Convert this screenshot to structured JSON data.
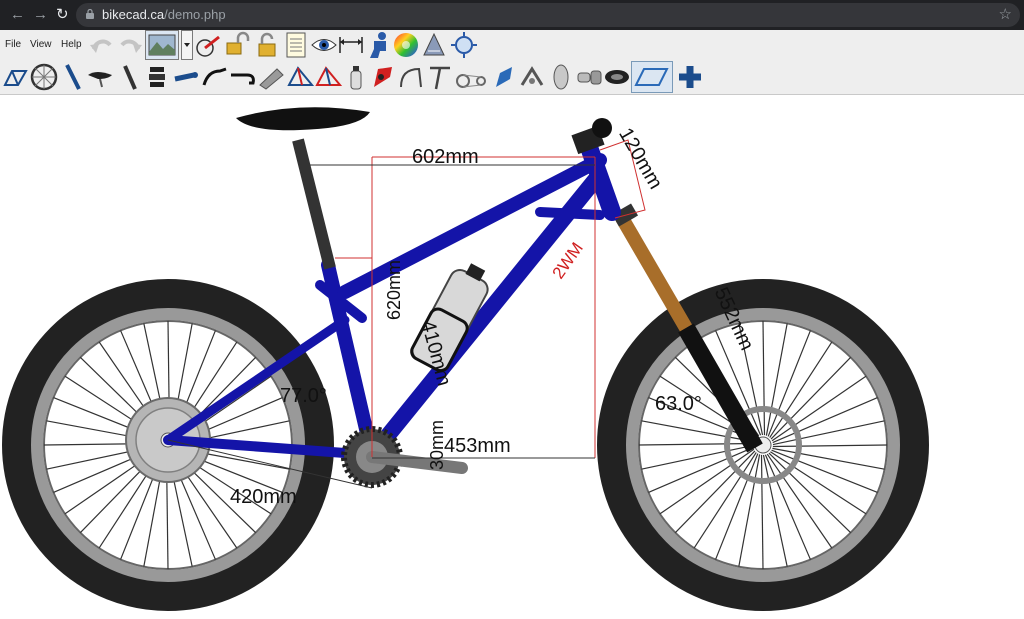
{
  "browser": {
    "back_glyph": "←",
    "forward_glyph": "→",
    "reload_glyph": "↻",
    "url_host": "bikecad.ca",
    "url_path": "/demo.php",
    "star_glyph": "☆"
  },
  "menu": {
    "file": "File",
    "view": "View",
    "help": "Help"
  },
  "toolbar_row1_icons": [
    "undo-icon",
    "redo-icon",
    "background-image-icon",
    "dropdown-arrow-icon",
    "bike-wheel-icon",
    "unlock-icon",
    "lock-icon",
    "notepad-icon",
    "eye-icon",
    "dimension-icon",
    "rider-icon",
    "color-wheel-icon",
    "sketch-icon",
    "zoom-fit-icon"
  ],
  "toolbar_row2_icons": [
    "frame-icon",
    "wheel-icon",
    "fork-icon",
    "saddle-icon",
    "seatpost-icon",
    "headset-icon",
    "stem-icon",
    "handlebar-icon",
    "drop-bar-icon",
    "crank-icon",
    "frame-red-blue-icon",
    "frame-blue-red-icon",
    "bottle-icon",
    "brake-hood-icon",
    "brake-icon",
    "stem-angle-icon",
    "drivetrain-icon",
    "derailleur-icon",
    "caliper-icon",
    "tube-icon",
    "shifter-icon",
    "gear-icon",
    "frame-outline-icon",
    "add-icon"
  ],
  "bike": {
    "decal_text": "2WM",
    "colors": {
      "frame": "#1414a8",
      "fork_stanchion": "#a86e2a",
      "dimension_line": "#d03030",
      "tire": "#222222"
    },
    "dimensions": {
      "top_tube": "602mm",
      "head_tube": "120mm",
      "seat_tube_c": "620mm",
      "seat_tube": "410mm",
      "fork_length": "552mm",
      "seat_angle": "77.0°",
      "head_angle": "63.0°",
      "bb_drop": "30mm",
      "reach": "453mm",
      "chainstay": "420mm"
    }
  }
}
